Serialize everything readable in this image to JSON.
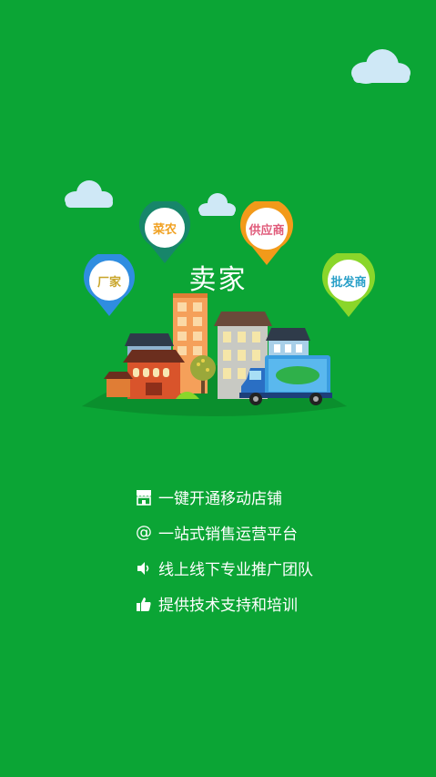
{
  "app": {
    "title": "卖家"
  },
  "pins": [
    {
      "label": "厂家",
      "ring_color": "#2f8de0",
      "text_color": "#f0a020"
    },
    {
      "label": "菜农",
      "ring_color": "#17866a",
      "text_color": "#f0a020"
    },
    {
      "label": "供应商",
      "ring_color": "#f29a1a",
      "text_color": "#e05a7a"
    },
    {
      "label": "批发商",
      "ring_color": "#8ad62a",
      "text_color": "#2aa0c8"
    }
  ],
  "features": [
    {
      "icon": "shop-icon",
      "text": "一键开通移动店铺"
    },
    {
      "icon": "at-icon",
      "text": "一站式销售运营平台"
    },
    {
      "icon": "speaker-icon",
      "text": "线上线下专业推广团队"
    },
    {
      "icon": "thumbs-up-icon",
      "text": "提供技术支持和培训"
    }
  ],
  "colors": {
    "background": "#0ba535",
    "hill": "#0a8f2d",
    "cloud": "#cfe8f6"
  }
}
